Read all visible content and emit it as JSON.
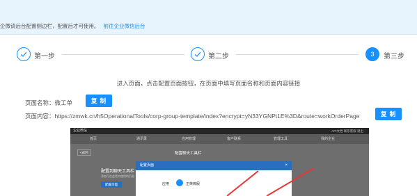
{
  "notice": {
    "text": "企微请后台配置侧边栏，配置后才可使用。",
    "link": "前往企业微信后台"
  },
  "steps": [
    {
      "label": "第一步",
      "icon": "check-icon",
      "status": "done"
    },
    {
      "label": "第二步",
      "icon": "check-icon",
      "status": "done"
    },
    {
      "label": "第三步",
      "number": "3",
      "status": "active"
    }
  ],
  "hint": "进入页面，点击配置页面按钮，在页面中填写页面名称和页面内容链接",
  "page_name": {
    "label": "页面名称：",
    "value": "微工单",
    "copy_label": "复 制"
  },
  "page_content": {
    "label": "页面内容：",
    "value": "https://zmwk.cn/h5OperationalTools/corp-group-template/index?encrypt=yN33YGNPt1E%3D&route=workOrderPage",
    "copy_label": "复 制"
  },
  "embedded_screenshot": {
    "logo": "企业微信",
    "top_links": "API文档  联系客服  退出",
    "nav": [
      "首页",
      "通讯录",
      "应用管理",
      "客户联系",
      "管理工具",
      "我的企业"
    ],
    "back": "<返回",
    "page_title": "配置聊天工具栏",
    "card_title": "配置到聊天工具栏",
    "card_sub": "添加可在会话中使用的页面",
    "card_button": "配置页面",
    "dialog_title": "配置页面",
    "dialog_close": "×",
    "app_label": "应用",
    "app_name": "正荣微服"
  },
  "colors": {
    "accent": "#1890ff",
    "notice_bg": "#e8f4fd",
    "arrow": "#e53935"
  }
}
